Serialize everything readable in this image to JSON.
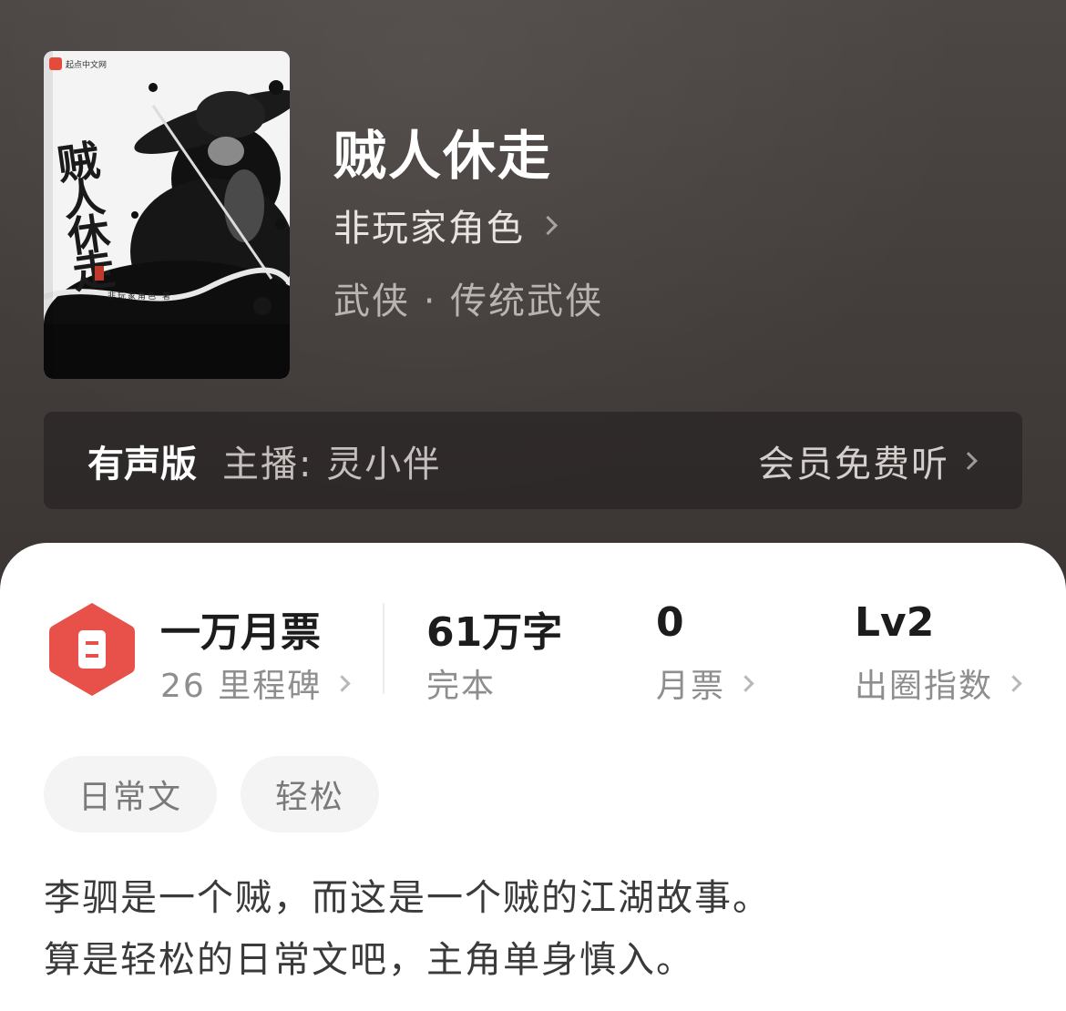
{
  "cover": {
    "logo_text": "起点中文网",
    "title_text": "贼人休走",
    "author_text": "非玩家角色 著"
  },
  "book": {
    "title": "贼人休走",
    "author": "非玩家角色",
    "genre": "武侠 · 传统武侠"
  },
  "audio": {
    "label": "有声版",
    "host": "主播: 灵小伴",
    "cta": "会员免费听"
  },
  "stats": {
    "badge_main": "一万月票",
    "badge_sub": "26 里程碑",
    "words_main": "61万字",
    "words_sub": "完本",
    "tickets_main": "0",
    "tickets_sub": "月票",
    "level_main": "Lv2",
    "level_sub": "出圈指数"
  },
  "tags": [
    "日常文",
    "轻松"
  ],
  "description": {
    "line1": "李驷是一个贼，而这是一个贼的江湖故事。",
    "line2": "算是轻松的日常文吧，主角单身慎入。"
  },
  "colors": {
    "header_bg": "#443e3c",
    "badge_red": "#e8504a",
    "white": "#ffffff"
  }
}
